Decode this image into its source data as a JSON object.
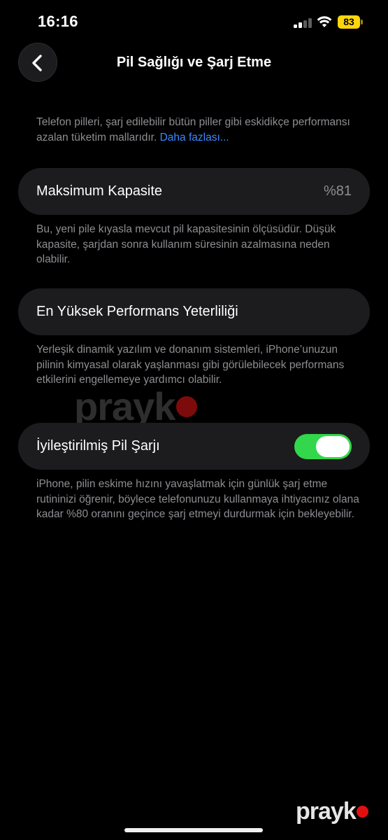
{
  "status_bar": {
    "time": "16:16",
    "battery_level": "83",
    "battery_color": "#ffd60a",
    "icons": [
      "signal-icon",
      "wifi-icon",
      "battery-icon"
    ]
  },
  "nav": {
    "title": "Pil Sağlığı ve Şarj Etme",
    "back_icon": "chevron-left-icon"
  },
  "intro": {
    "text": "Telefon pilleri, şarj edilebilir bütün piller gibi eskidikçe performansı azalan tüketim mallarıdır. ",
    "link": "Daha fazlası..."
  },
  "max_capacity": {
    "label": "Maksimum Kapasite",
    "value": "%81",
    "description": "Bu, yeni pile kıyasla mevcut pil kapasitesinin ölçüsüdür. Düşük kapasite, şarjdan sonra kullanım süresinin azalmasına neden olabilir."
  },
  "peak_performance": {
    "label": "En Yüksek Performans Yeterliliği",
    "description": "Yerleşik dinamik yazılım ve donanım sistemleri, iPhone’unuzun pilinin kimyasal olarak yaşlanması gibi görülebilecek performans etkilerini engellemeye yardımcı olabilir."
  },
  "optimized_charging": {
    "label": "İyileştirilmiş Pil Şarjı",
    "enabled": true,
    "toggle_color": "#32d74b",
    "description": "iPhone, pilin eskime hızını yavaşlatmak için günlük şarj etme rutininizi öğrenir, böylece telefonunuzu kullanmaya ihtiyacınız olana kadar %80 oranını geçince şarj etmeyi durdurmak için bekleyebilir."
  },
  "watermark": {
    "text": "prayk"
  },
  "colors": {
    "background": "#000000",
    "cell": "#1c1c1e",
    "secondary_text": "#8e8e93",
    "link": "#3a8bff"
  }
}
